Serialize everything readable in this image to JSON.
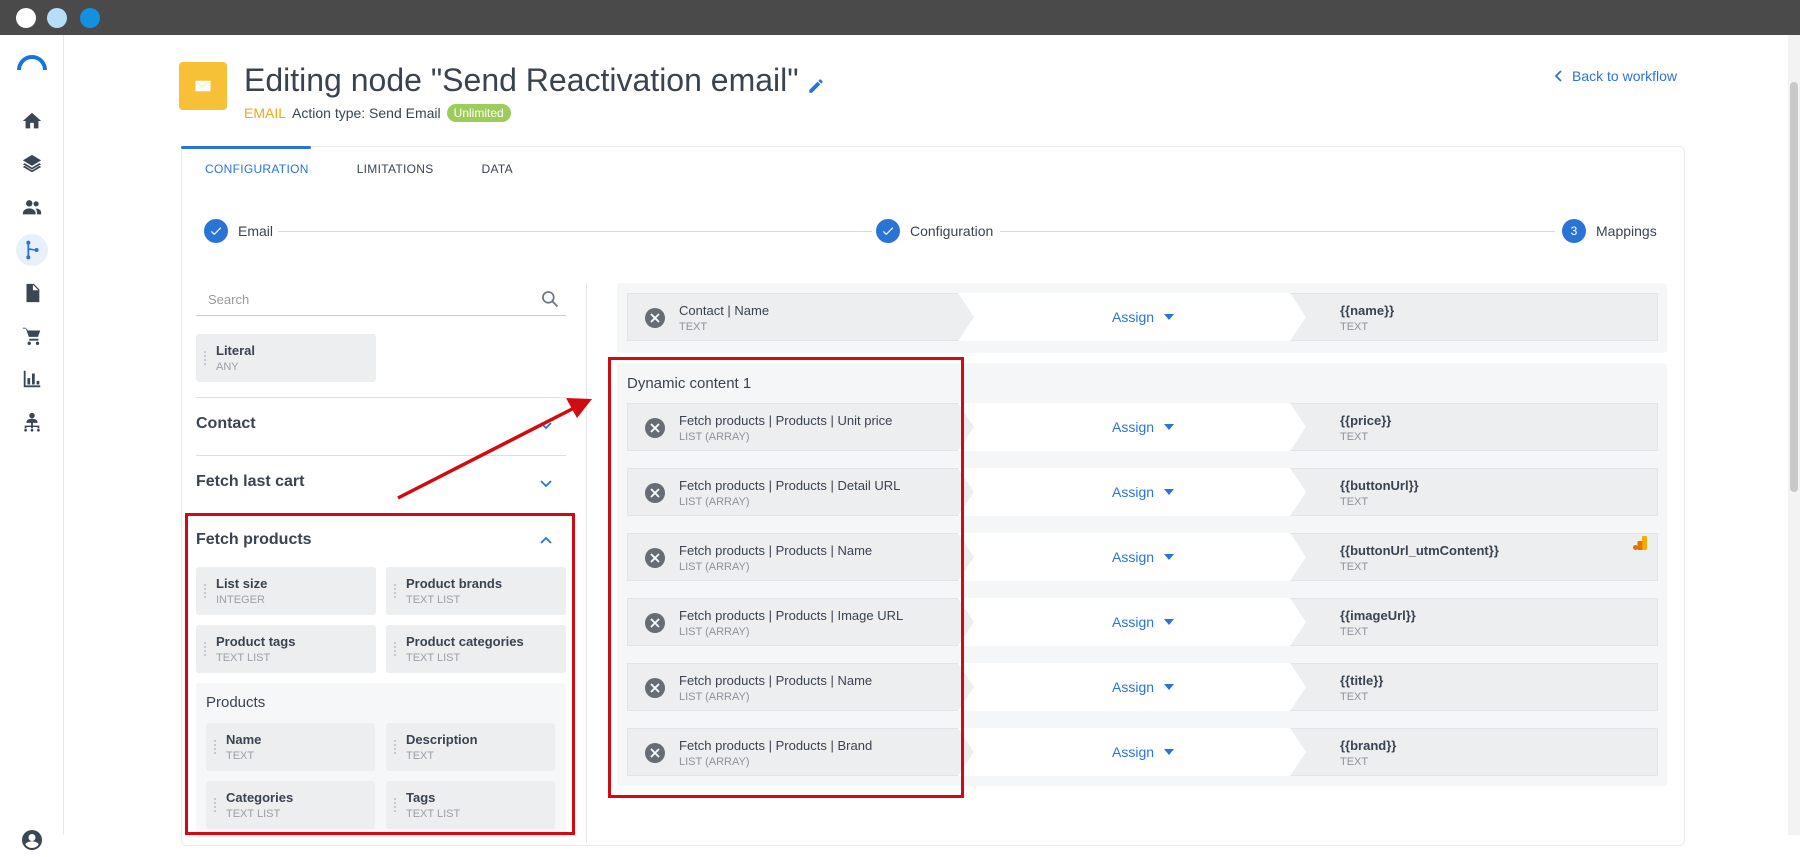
{
  "header": {
    "title": "Editing node \"Send Reactivation email\"",
    "type_label": "EMAIL",
    "action_label": "Action type: Send Email",
    "badge": "Unlimited",
    "back_link": "Back to workflow"
  },
  "tabs": [
    {
      "label": "CONFIGURATION",
      "active": true
    },
    {
      "label": "LIMITATIONS",
      "active": false
    },
    {
      "label": "DATA",
      "active": false
    }
  ],
  "steps": [
    {
      "label": "Email",
      "marker": "check"
    },
    {
      "label": "Configuration",
      "marker": "check"
    },
    {
      "label": "Mappings",
      "marker": "3"
    }
  ],
  "search": {
    "placeholder": "Search",
    "value": ""
  },
  "literal": {
    "name": "Literal",
    "type": "ANY"
  },
  "sections": {
    "contact": "Contact",
    "fetch_last_cart": "Fetch last cart",
    "fetch_products": "Fetch products"
  },
  "fetch_products_fields": [
    {
      "name": "List size",
      "type": "INTEGER"
    },
    {
      "name": "Product brands",
      "type": "TEXT LIST"
    },
    {
      "name": "Product tags",
      "type": "TEXT LIST"
    },
    {
      "name": "Product categories",
      "type": "TEXT LIST"
    }
  ],
  "products": {
    "label": "Products",
    "fields": [
      {
        "name": "Name",
        "type": "TEXT"
      },
      {
        "name": "Description",
        "type": "TEXT"
      },
      {
        "name": "Categories",
        "type": "TEXT LIST"
      },
      {
        "name": "Tags",
        "type": "TEXT LIST"
      }
    ]
  },
  "mapping_top": {
    "source": "Contact | Name",
    "source_type": "TEXT",
    "action": "Assign",
    "target": "{{name}}",
    "target_type": "TEXT"
  },
  "dynamic_content": {
    "title": "Dynamic content 1",
    "rows": [
      {
        "source": "Fetch products | Products | Unit price",
        "source_type": "LIST (ARRAY)",
        "action": "Assign",
        "target": "{{price}}",
        "target_type": "TEXT"
      },
      {
        "source": "Fetch products | Products | Detail URL",
        "source_type": "LIST (ARRAY)",
        "action": "Assign",
        "target": "{{buttonUrl}}",
        "target_type": "TEXT"
      },
      {
        "source": "Fetch products | Products | Name",
        "source_type": "LIST (ARRAY)",
        "action": "Assign",
        "target": "{{buttonUrl_utmContent}}",
        "target_type": "TEXT"
      },
      {
        "source": "Fetch products | Products | Image URL",
        "source_type": "LIST (ARRAY)",
        "action": "Assign",
        "target": "{{imageUrl}}",
        "target_type": "TEXT"
      },
      {
        "source": "Fetch products | Products | Name",
        "source_type": "LIST (ARRAY)",
        "action": "Assign",
        "target": "{{title}}",
        "target_type": "TEXT"
      },
      {
        "source": "Fetch products | Products | Brand",
        "source_type": "LIST (ARRAY)",
        "action": "Assign",
        "target": "{{brand}}",
        "target_type": "TEXT"
      }
    ]
  },
  "colors": {
    "accent": "#2a74d8",
    "node_icon": "#f6c037",
    "badge": "#9ccd5a",
    "annotation": "#d10b12"
  },
  "icons": {
    "nav": [
      "home-icon",
      "layers-icon",
      "people-icon",
      "workflow-icon",
      "document-icon",
      "cart-icon",
      "chart-icon",
      "org-chart-icon"
    ],
    "user": "account-icon"
  }
}
